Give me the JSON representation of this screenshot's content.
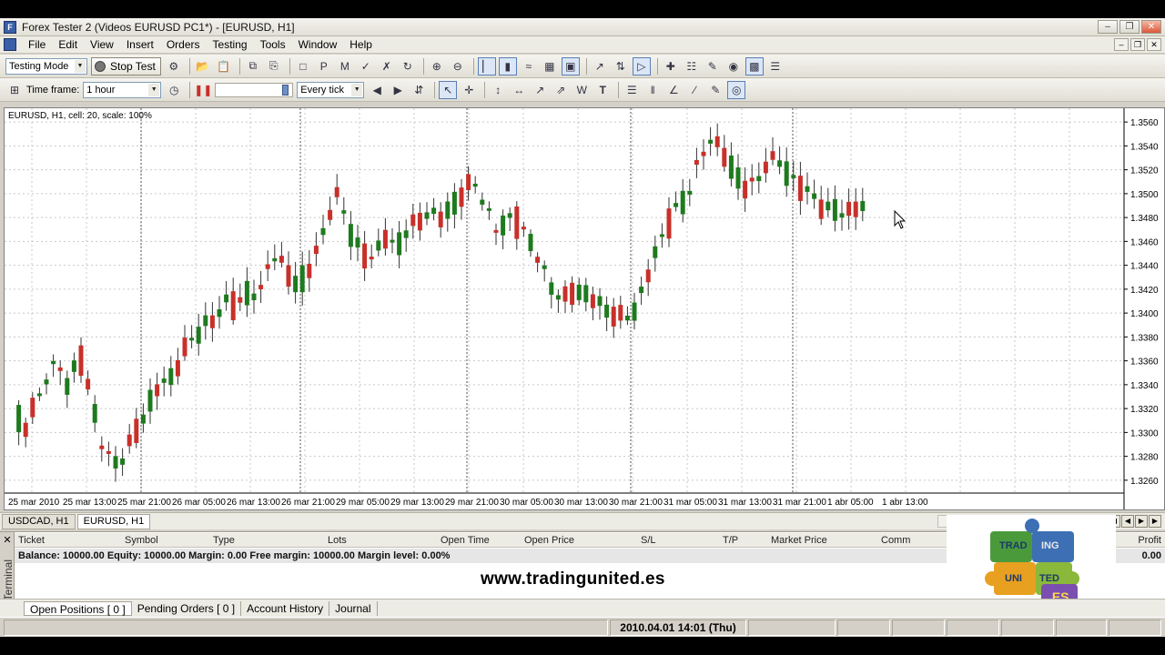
{
  "window": {
    "title": "Forex Tester 2  (Videos EURUSD PC1*) - [EURUSD, H1]",
    "app_icon": "app-icon"
  },
  "menu": [
    "File",
    "Edit",
    "View",
    "Insert",
    "Orders",
    "Testing",
    "Tools",
    "Window",
    "Help"
  ],
  "toolbar1": {
    "mode_value": "Testing Mode",
    "stop_label": "Stop Test"
  },
  "toolbar2": {
    "timeframe_label": "Time frame:",
    "timeframe_value": "1 hour",
    "tick_value": "Every tick"
  },
  "chart": {
    "label": "EURUSD, H1, cell: 20, scale: 100%"
  },
  "chart_data": {
    "type": "candlestick",
    "symbol": "EURUSD",
    "timeframe": "H1",
    "price_ticks": [
      "1.3560",
      "1.3540",
      "1.3520",
      "1.3500",
      "1.3480",
      "1.3460",
      "1.3440",
      "1.3420",
      "1.3400",
      "1.3380",
      "1.3360",
      "1.3340",
      "1.3320",
      "1.3300",
      "1.3280",
      "1.3260"
    ],
    "time_labels": [
      "25 mar 2010",
      "25 mar 13:00",
      "25 mar 21:00",
      "26 mar 05:00",
      "26 mar 13:00",
      "26 mar 21:00",
      "29 mar 05:00",
      "29 mar 13:00",
      "29 mar 21:00",
      "30 mar 05:00",
      "30 mar 13:00",
      "30 mar 21:00",
      "31 mar 05:00",
      "31 mar 13:00",
      "31 mar 21:00",
      "1 abr 05:00",
      "1 abr 13:00"
    ],
    "ylim": [
      1.325,
      1.357
    ],
    "up_color": "#1e7a1e",
    "down_color": "#c8302a",
    "close_path": [
      1.333,
      1.33,
      1.332,
      1.3345,
      1.336,
      1.334,
      1.3365,
      1.333,
      1.329,
      1.3275,
      1.328,
      1.33,
      1.332,
      1.334,
      1.3345,
      1.336,
      1.338,
      1.339,
      1.3395,
      1.341,
      1.3405,
      1.342,
      1.3415,
      1.345,
      1.344,
      1.3425,
      1.343,
      1.345,
      1.348,
      1.35,
      1.347,
      1.345,
      1.3445,
      1.3465,
      1.3455,
      1.347,
      1.3475,
      1.3485,
      1.348,
      1.349,
      1.35,
      1.351,
      1.349,
      1.347,
      1.348,
      1.3475,
      1.346,
      1.344,
      1.342,
      1.341,
      1.342,
      1.3415,
      1.341,
      1.34,
      1.3395,
      1.34,
      1.342,
      1.345,
      1.347,
      1.349,
      1.35,
      1.353,
      1.3545,
      1.3535,
      1.352,
      1.3505,
      1.351,
      1.3525,
      1.353,
      1.3515,
      1.3505,
      1.35,
      1.3485,
      1.349,
      1.348,
      1.349
    ]
  },
  "chart_tabs": [
    "USDCAD, H1",
    "EURUSD, H1"
  ],
  "terminal": {
    "side_label": "Terminal",
    "columns": [
      "Ticket",
      "Symbol",
      "Type",
      "Lots",
      "Open Time",
      "Open Price",
      "S/L",
      "T/P",
      "Market Price",
      "Comm",
      "Profit"
    ],
    "balance_row": "Balance: 10000.00 Equity: 10000.00 Margin: 0.00 Free margin: 10000.00 Margin level: 0.00%",
    "profit_value": "0.00",
    "tabs": [
      "Open Positions  [ 0 ]",
      "Pending Orders  [ 0 ]",
      "Account History",
      "Journal"
    ]
  },
  "watermark": "www.tradingunited.es",
  "logo": {
    "line1": "TRAD",
    "line1b": "ING",
    "line2": "UNI",
    "line2b": "TED",
    "line3": ".ES"
  },
  "status": {
    "datetime": "2010.04.01 14:01 (Thu)"
  }
}
